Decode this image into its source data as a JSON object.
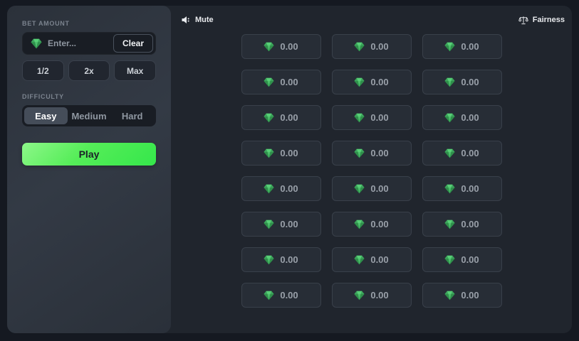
{
  "colors": {
    "outer_bg": "#151921",
    "card_bg": "#20252d",
    "sidebar_bg": "#2f353f",
    "panel_dark": "#191d24",
    "accent_green": "#35e74b",
    "gem_green": "#46b968",
    "text_muted": "#99a0a9",
    "text_light": "#e8eaed"
  },
  "sidebar": {
    "bet_amount_label": "BET AMOUNT",
    "bet_input": {
      "value": "",
      "placeholder": "Enter...",
      "clear_label": "Clear"
    },
    "quick_buttons": [
      {
        "label": "1/2"
      },
      {
        "label": "2x"
      },
      {
        "label": "Max"
      }
    ],
    "difficulty_label": "DIFFICULTY",
    "difficulty_options": [
      {
        "label": "Easy",
        "selected": true
      },
      {
        "label": "Medium",
        "selected": false
      },
      {
        "label": "Hard",
        "selected": false
      }
    ],
    "play_label": "Play"
  },
  "topbar": {
    "mute_label": "Mute",
    "fairness_label": "Fairness"
  },
  "grid": {
    "rows": 8,
    "cols": 3,
    "values": [
      "0.00",
      "0.00",
      "0.00",
      "0.00",
      "0.00",
      "0.00",
      "0.00",
      "0.00",
      "0.00",
      "0.00",
      "0.00",
      "0.00",
      "0.00",
      "0.00",
      "0.00",
      "0.00",
      "0.00",
      "0.00",
      "0.00",
      "0.00",
      "0.00",
      "0.00",
      "0.00",
      "0.00"
    ]
  }
}
